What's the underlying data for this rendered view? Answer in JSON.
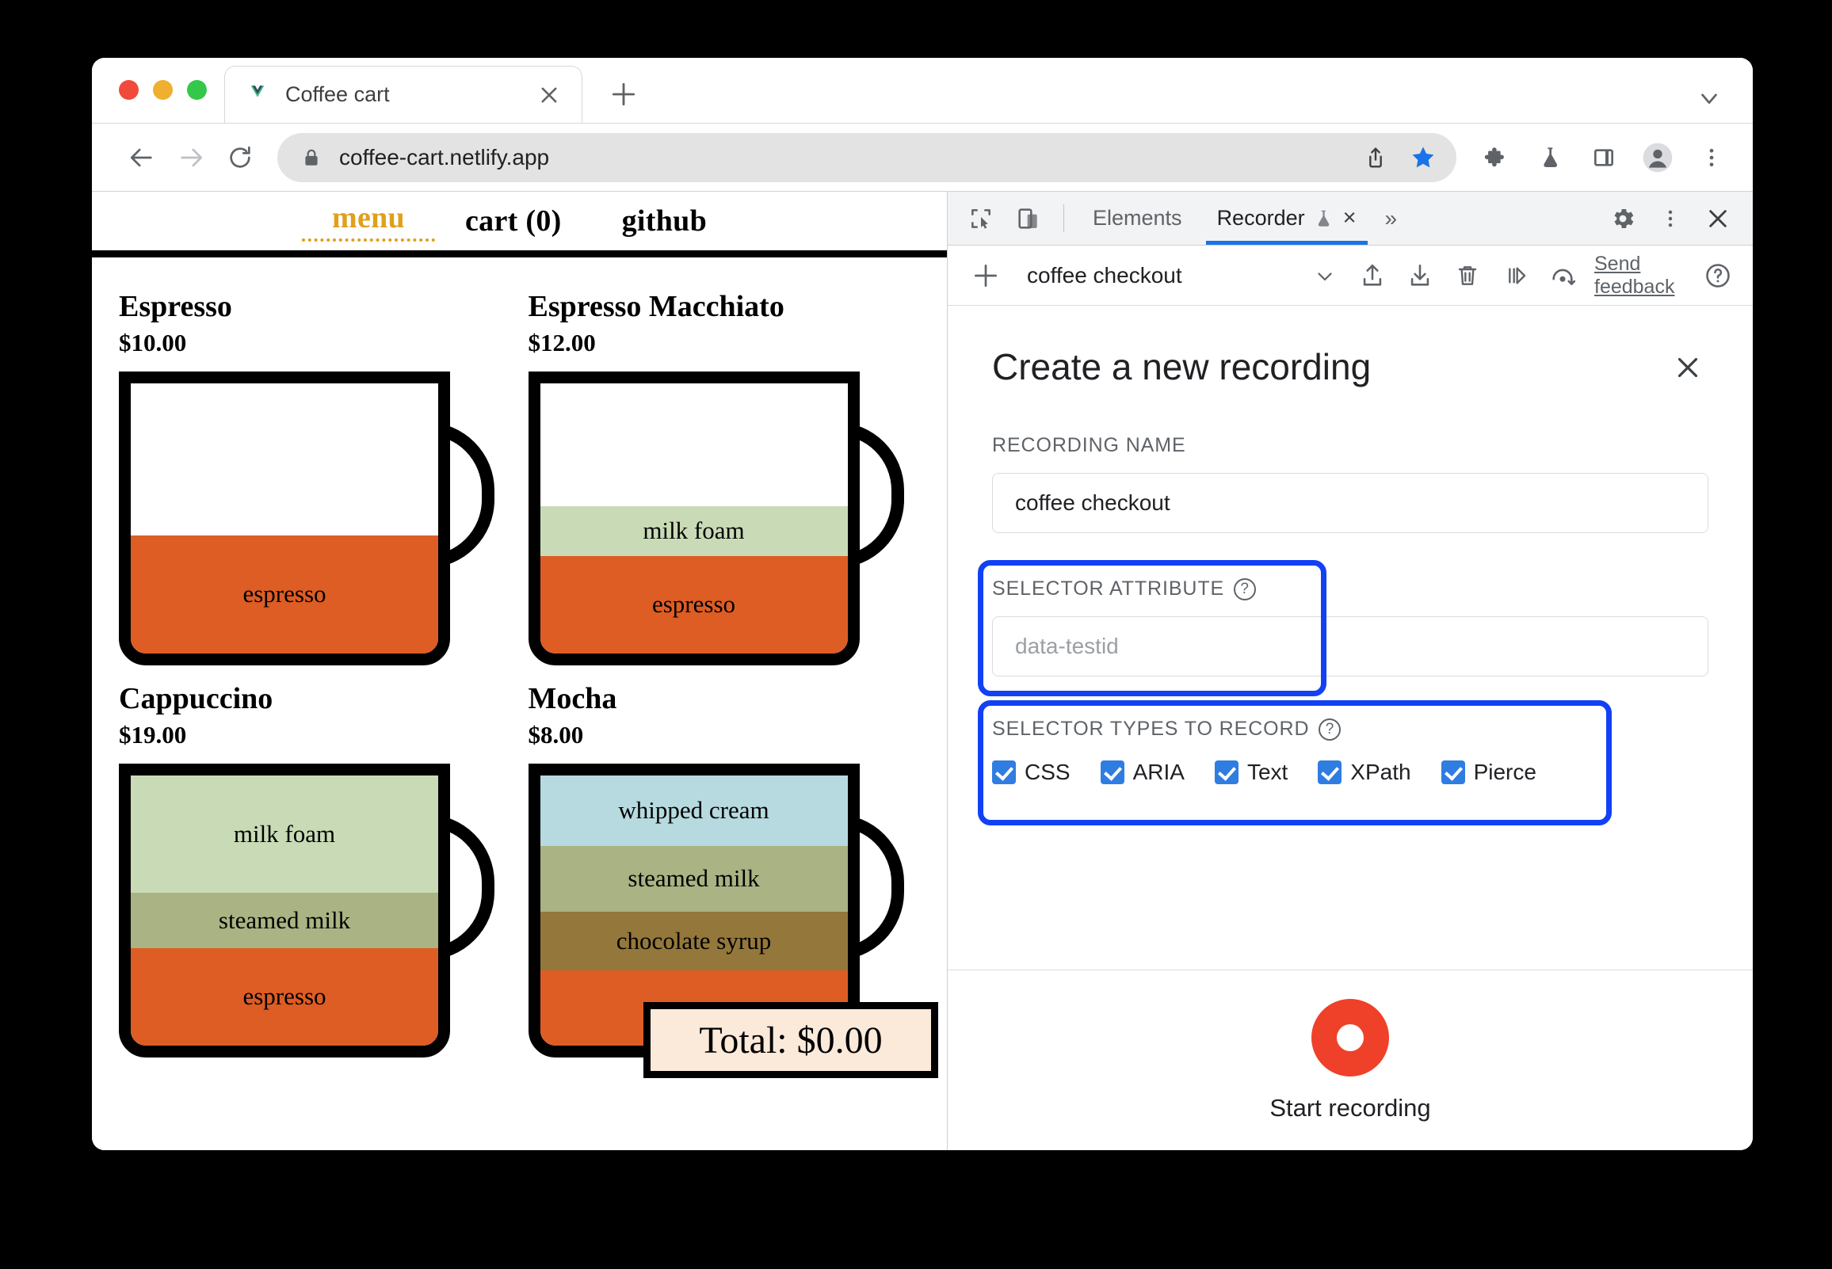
{
  "browser": {
    "tab": {
      "favicon": "vue-logo-icon",
      "title": "Coffee cart",
      "close_label": "×"
    },
    "new_tab_label": "+",
    "tabstrip_chevron": "chevron-down-icon",
    "address": {
      "back_icon": "back-arrow-icon",
      "forward_icon": "forward-arrow-icon",
      "reload_icon": "reload-icon",
      "lock_icon": "lock-icon",
      "url": "coffee-cart.netlify.app",
      "share_icon": "share-icon",
      "bookmark_icon": "star-icon",
      "extensions_icon": "puzzle-icon",
      "labs_icon": "flask-icon",
      "sidepanel_icon": "side-panel-icon",
      "profile_icon": "avatar-icon",
      "menu_icon": "three-dot-menu-icon"
    }
  },
  "page": {
    "nav": [
      {
        "label": "menu",
        "active": true
      },
      {
        "label": "cart (0)",
        "active": false
      },
      {
        "label": "github",
        "active": false
      }
    ],
    "products": [
      {
        "name": "Espresso",
        "price": "$10.00",
        "layers": [
          {
            "label": "",
            "color": "#ffffff",
            "height": 192
          },
          {
            "label": "espresso",
            "color": "#DD5D24",
            "height": 149
          }
        ]
      },
      {
        "name": "Espresso Macchiato",
        "price": "$12.00",
        "layers": [
          {
            "label": "",
            "color": "#ffffff",
            "height": 155
          },
          {
            "label": "milk foam",
            "color": "#C9DBB6",
            "height": 63
          },
          {
            "label": "espresso",
            "color": "#DD5D24",
            "height": 123
          }
        ]
      },
      {
        "name": "Cappuccino",
        "price": "$19.00",
        "layers": [
          {
            "label": "milk foam",
            "color": "#C9DBB6",
            "height": 148
          },
          {
            "label": "steamed milk",
            "color": "#A9B383",
            "height": 70
          },
          {
            "label": "espresso",
            "color": "#DD5D24",
            "height": 123
          }
        ]
      },
      {
        "name": "Mocha",
        "price": "$8.00",
        "layers": [
          {
            "label": "whipped cream",
            "color": "#B6DADF",
            "height": 89
          },
          {
            "label": "steamed milk",
            "color": "#A9B383",
            "height": 83
          },
          {
            "label": "chocolate syrup",
            "color": "#94773A",
            "height": 74
          },
          {
            "label": "",
            "color": "#DD5D24",
            "height": 95
          }
        ]
      }
    ],
    "total_label": "Total: $0.00"
  },
  "devtools": {
    "tabbar": {
      "inspect_icon": "inspect-element-icon",
      "device_icon": "device-toolbar-icon",
      "tabs": [
        {
          "label": "Elements",
          "selected": false,
          "icon": null,
          "closable": false
        },
        {
          "label": "Recorder",
          "selected": true,
          "icon": "flask-icon",
          "closable": true
        }
      ],
      "close_tab_label": "×",
      "more_tabs_label": "»",
      "settings_icon": "gear-icon",
      "more_icon": "three-dot-menu-icon",
      "close_icon": "close-icon"
    },
    "recorder_toolbar": {
      "add_icon": "plus-icon",
      "recording_name": "coffee checkout",
      "dropdown_icon": "chevron-down-icon",
      "import_icon": "upload-icon",
      "export_icon": "download-icon",
      "delete_icon": "trash-icon",
      "replay_icon": "replay-step-icon",
      "performance_icon": "measure-performance-icon",
      "feedback_label": "Send feedback",
      "help_icon": "question-mark-icon"
    },
    "panel": {
      "title": "Create a new recording",
      "close_label": "✕",
      "recording_name_label": "RECORDING NAME",
      "recording_name_value": "coffee checkout",
      "selector_attribute_label": "SELECTOR ATTRIBUTE",
      "selector_attribute_help": "?",
      "selector_attribute_placeholder": "data-testid",
      "selector_types_label": "SELECTOR TYPES TO RECORD",
      "selector_types_help": "?",
      "selector_types": [
        {
          "label": "CSS",
          "checked": true
        },
        {
          "label": "ARIA",
          "checked": true
        },
        {
          "label": "Text",
          "checked": true
        },
        {
          "label": "XPath",
          "checked": true
        },
        {
          "label": "Pierce",
          "checked": true
        }
      ],
      "start_button_label": "Start recording",
      "record_dot_color": "#ef4129",
      "highlight_color": "#1241f5"
    }
  }
}
